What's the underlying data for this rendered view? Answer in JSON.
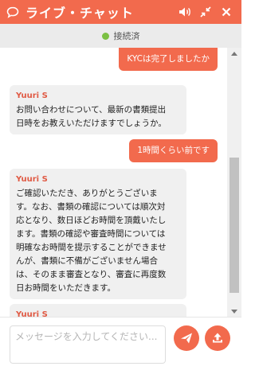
{
  "header": {
    "title": "ライブ・チャット"
  },
  "status": {
    "text": "接続済",
    "color": "#7bc043"
  },
  "messages": [
    {
      "role": "user",
      "text": "KYCは完了しましたか"
    },
    {
      "role": "agent",
      "sender": "Yuuri S",
      "text": "お問い合わせについて、最新の書類提出\n日時をお教えいただけますでしょうか。"
    },
    {
      "role": "user",
      "text": "1時間くらい前です"
    },
    {
      "role": "agent",
      "sender": "Yuuri S",
      "text": "ご確認いただき、ありがとうございま\nす。なお、書類の確認については順次対\n応となり、数日ほどお時間を頂戴いたし\nます。書類の確認や審査時間については\n明確なお時間を提示することができませ\nんが、書類に不備がございません場合\nは、そのまま審査となり、審査に再度数\n日お時間をいただきます。"
    },
    {
      "role": "agent",
      "sender": "Yuuri S",
      "text": ""
    }
  ],
  "composer": {
    "placeholder": "メッセージを入力してください..."
  },
  "colors": {
    "accent": "#f26a4d",
    "agent_name": "#e05a44",
    "agent_bubble": "#f0f0f0"
  },
  "icons": {
    "header": [
      "chat-bubble-icon",
      "volume-icon",
      "minimize-icon",
      "close-icon"
    ],
    "composer": [
      "send-icon",
      "upload-icon"
    ]
  }
}
